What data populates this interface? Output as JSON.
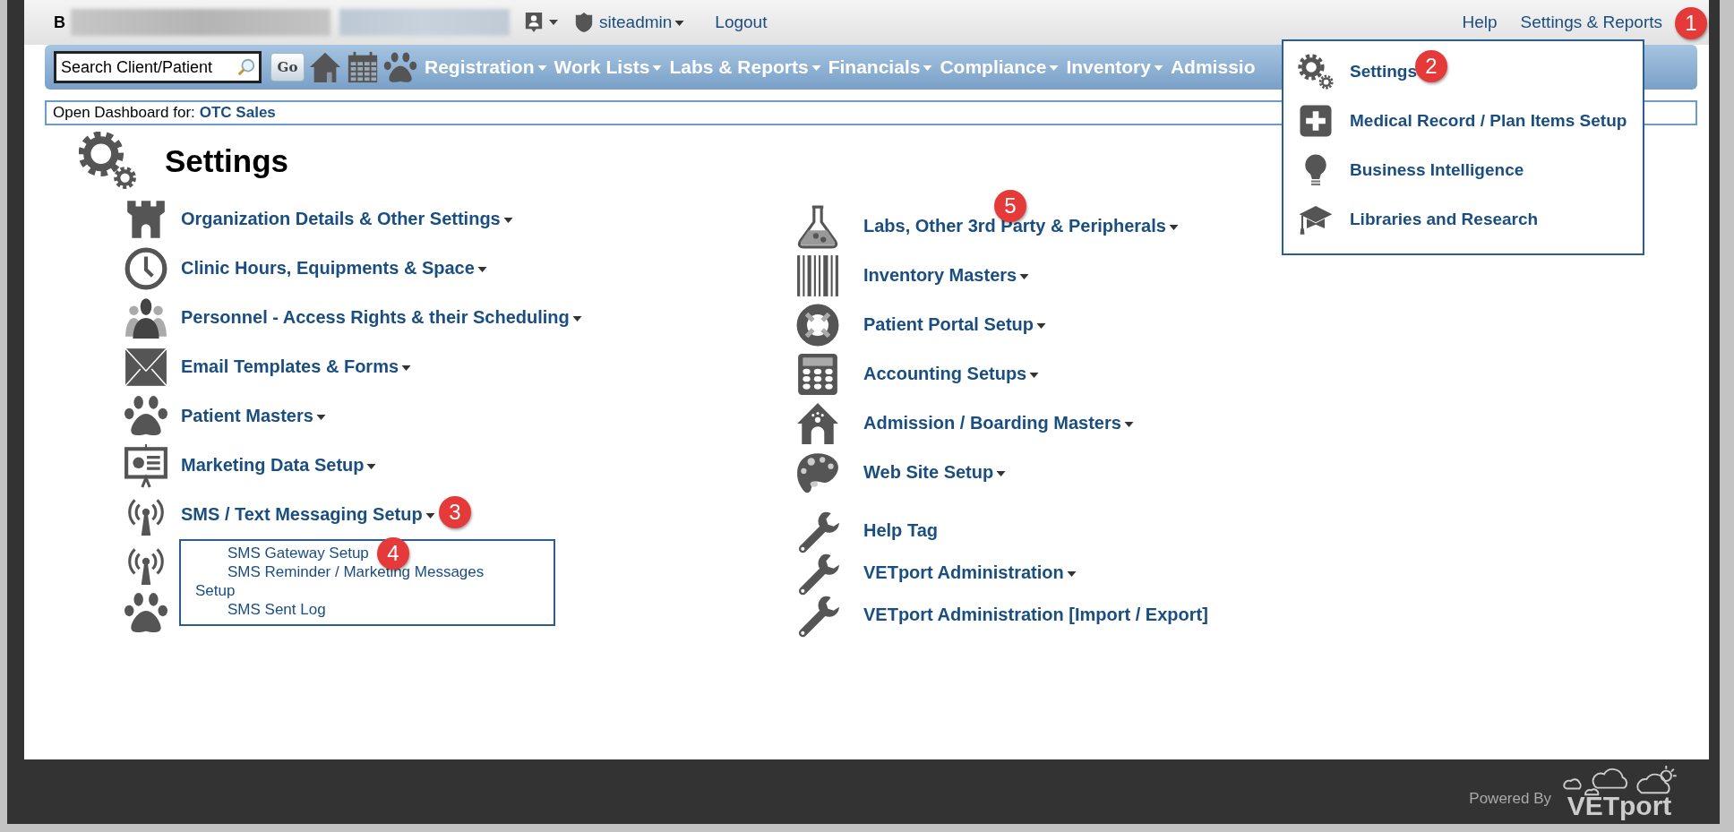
{
  "top_bar": {
    "initial": "B",
    "user_menu": "siteadmin",
    "logout": "Logout",
    "help": "Help",
    "settings_reports": "Settings & Reports"
  },
  "search": {
    "placeholder": "Search Client/Patient",
    "button": "Go"
  },
  "nav": [
    {
      "label": "Registration",
      "has_menu": true
    },
    {
      "label": "Work Lists",
      "has_menu": true
    },
    {
      "label": "Labs & Reports",
      "has_menu": true
    },
    {
      "label": "Financials",
      "has_menu": true
    },
    {
      "label": "Compliance",
      "has_menu": true
    },
    {
      "label": "Inventory",
      "has_menu": true
    },
    {
      "label": "Admissio",
      "has_menu": false
    }
  ],
  "dashboard": {
    "label": "Open Dashboard for:",
    "value": "OTC Sales"
  },
  "page_title": "Settings",
  "left_items": [
    {
      "kind": "castle",
      "label": "Organization Details & Other Settings",
      "has_menu": true
    },
    {
      "kind": "clock",
      "label": "Clinic Hours, Equipments & Space",
      "has_menu": true
    },
    {
      "kind": "people",
      "label": "Personnel - Access Rights & their Scheduling",
      "has_menu": true
    },
    {
      "kind": "envelope",
      "label": "Email Templates & Forms",
      "has_menu": true
    },
    {
      "kind": "paw",
      "label": "Patient Masters",
      "has_menu": true
    },
    {
      "kind": "easel",
      "label": "Marketing Data Setup",
      "has_menu": true
    },
    {
      "kind": "antenna",
      "label": "SMS / Text Messaging Setup",
      "has_menu": true
    },
    {
      "kind": "antenna"
    },
    {
      "kind": "paw"
    }
  ],
  "right_items": [
    {
      "kind": "flask",
      "label": "Labs, Other 3rd Party & Peripherals",
      "has_menu": true
    },
    {
      "kind": "barcode",
      "label": "Inventory Masters",
      "has_menu": true
    },
    {
      "kind": "lifebuoy",
      "label": "Patient Portal Setup",
      "has_menu": true
    },
    {
      "kind": "calculator",
      "label": "Accounting Setups",
      "has_menu": true
    },
    {
      "kind": "doghouse",
      "label": "Admission / Boarding Masters",
      "has_menu": true
    },
    {
      "kind": "palette",
      "label": "Web Site Setup",
      "has_menu": true
    },
    {
      "kind": "wrench",
      "label": "Help Tag",
      "has_menu": false
    },
    {
      "kind": "wrench",
      "label": "VETport Administration",
      "has_menu": true
    },
    {
      "kind": "wrench",
      "label": "VETport Administration [Import / Export]",
      "has_menu": false
    }
  ],
  "settings_menu": [
    {
      "kind": "gears",
      "label": "Settings"
    },
    {
      "kind": "plus",
      "label": "Medical Record / Plan Items Setup"
    },
    {
      "kind": "bulb",
      "label": "Business Intelligence"
    },
    {
      "kind": "cap",
      "label": "Libraries and Research"
    }
  ],
  "sms_submenu": [
    "SMS Gateway Setup",
    "SMS Reminder / Marketing Messages Setup",
    "SMS Sent Log"
  ],
  "callouts": [
    "1",
    "2",
    "3",
    "4",
    "5"
  ],
  "footer": {
    "powered_by": "Powered By",
    "logo": "VETport"
  }
}
